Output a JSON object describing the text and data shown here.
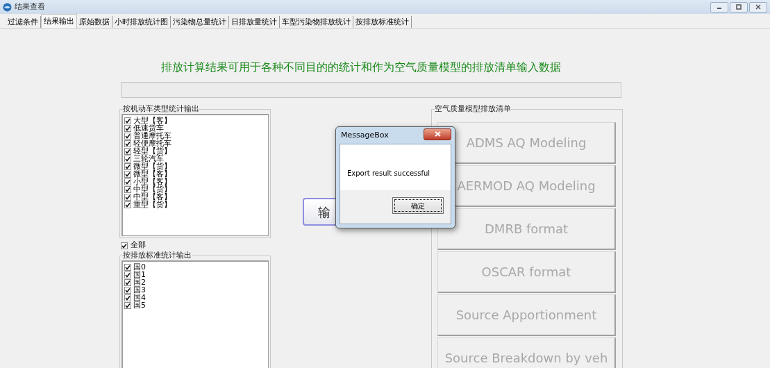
{
  "window": {
    "title": "结果查看"
  },
  "tabs": [
    {
      "label": "过滤条件",
      "selected": false
    },
    {
      "label": "结果输出",
      "selected": true
    },
    {
      "label": "原始数据",
      "selected": false
    },
    {
      "label": "小时排放统计图",
      "selected": false
    },
    {
      "label": "污染物总量统计",
      "selected": false
    },
    {
      "label": "日排放量统计",
      "selected": false
    },
    {
      "label": "车型污染物排放统计",
      "selected": false
    },
    {
      "label": "按排放标准统计",
      "selected": false
    }
  ],
  "heading": "排放计算结果可用于各种不同目的的统计和作为空气质量模型的排放清单输入数据",
  "vehicle_group": {
    "title": "按机动车类型统计输出",
    "items": [
      {
        "label": "大型【客】",
        "checked": true
      },
      {
        "label": "低速货车",
        "checked": true
      },
      {
        "label": "普通摩托车",
        "checked": true
      },
      {
        "label": "轻便摩托车",
        "checked": true
      },
      {
        "label": "轻型【货】",
        "checked": true
      },
      {
        "label": "三轮汽车",
        "checked": true
      },
      {
        "label": "微型【货】",
        "checked": true
      },
      {
        "label": "微型【客】",
        "checked": true
      },
      {
        "label": "小型【客】",
        "checked": true
      },
      {
        "label": "中型【货】",
        "checked": true
      },
      {
        "label": "中型【客】",
        "checked": true
      },
      {
        "label": "重型【货】",
        "checked": true
      }
    ]
  },
  "all_checkbox": {
    "label": "全部",
    "checked": true
  },
  "standard_group": {
    "title": "按排放标准统计输出",
    "items": [
      {
        "label": "国0",
        "checked": true
      },
      {
        "label": "国1",
        "checked": true
      },
      {
        "label": "国2",
        "checked": true
      },
      {
        "label": "国3",
        "checked": true
      },
      {
        "label": "国4",
        "checked": true
      },
      {
        "label": "国5",
        "checked": true
      }
    ]
  },
  "output_button": {
    "label": "输"
  },
  "model_group": {
    "title": "空气质量模型排放清单",
    "buttons": [
      {
        "label": "ADMS AQ Modeling",
        "disabled": true
      },
      {
        "label": "AERMOD AQ Modeling",
        "disabled": true
      },
      {
        "label": "DMRB format",
        "disabled": true
      },
      {
        "label": "OSCAR format",
        "disabled": true
      },
      {
        "label": "Source Apportionment",
        "disabled": true
      },
      {
        "label": "Source Breakdown by veh",
        "disabled": true
      }
    ]
  },
  "dialog": {
    "title": "MessageBox",
    "message": "Export result successful",
    "ok": "确定"
  }
}
